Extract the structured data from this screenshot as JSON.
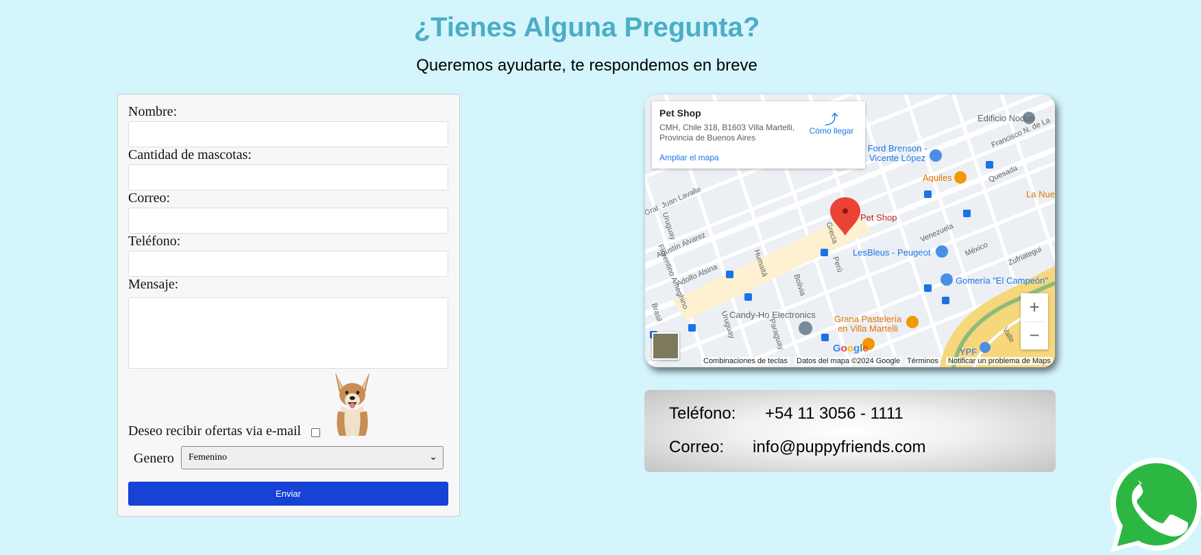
{
  "header": {
    "title": "¿Tienes Alguna Pregunta?",
    "subtitle": "Queremos ayudarte, te respondemos en breve"
  },
  "form": {
    "name_label": "Nombre:",
    "pets_label": "Cantidad de mascotas:",
    "email_label": "Correo:",
    "phone_label": "Teléfono:",
    "message_label": "Mensaje:",
    "name_value": "",
    "pets_value": "",
    "email_value": "",
    "phone_value": "",
    "message_value": "",
    "offers_label": "Deseo recibir ofertas via e-mail",
    "offers_checked": false,
    "gender_label": "Genero",
    "gender_selected": "Femenino",
    "submit_label": "Enviar",
    "dog_image": "smiling-dog-photo"
  },
  "map": {
    "place_name": "Pet Shop",
    "address": "CMH, Chile 318, B1603 Villa Martelli, Provincia de Buenos Aires",
    "directions_label": "Cómo llegar",
    "enlarge_label": "Ampliar el mapa",
    "zoom_in": "+",
    "zoom_out": "−",
    "attribution": {
      "shortcuts": "Combinaciones de teclas",
      "data": "Datos del mapa ©2024 Google",
      "terms": "Términos",
      "report": "Notificar un problema de Maps"
    },
    "logo": "Google",
    "places": {
      "pin": "Pet Shop",
      "nodus": "Edificio Nodus",
      "ford": "Ford Brenson - Vicente López",
      "aquiles": "Aquiles",
      "lanue": "La Nue",
      "lesbleus": "LesBleus - Peugeot",
      "gomeria": "Gomería \"El Campeón\"",
      "candy": "Candy-Ho Electronics",
      "grana": "Grana Pastelería en Villa Martelli",
      "ypf": "YPF"
    },
    "streets": {
      "lavalle": "Gral. Juan Lavalle",
      "uruguay": "Uruguay",
      "alvarez": "Agustín Álvarez",
      "ameghino": "Florentino Ameghino",
      "alsina": "Adolfo Alsina",
      "humaita": "Humaitá",
      "bolivia": "Bolivia",
      "grecia": "Grecia",
      "peru": "Perú",
      "venezuela": "Venezuela",
      "mexico": "México",
      "quesada": "Quesada",
      "laprida": "Francisco N. de La",
      "zufriategui": "Zufriategui",
      "paraguay": "Paraguay",
      "brasil": "Brasil",
      "valle": "Valle",
      "uruguay2": "Uruguay"
    }
  },
  "contact": {
    "phone_label": "Teléfono:",
    "phone_value": "+54 11 3056 - 1111",
    "email_label": "Correo:",
    "email_value": "info@puppyfriends.com"
  },
  "whatsapp": {
    "icon": "whatsapp-icon"
  },
  "colors": {
    "background": "#d4f5fc",
    "title": "#4aaec5",
    "button": "#1742d6",
    "link": "#1a73e8",
    "pin": "#ea4335",
    "whatsapp": "#2cb742"
  }
}
